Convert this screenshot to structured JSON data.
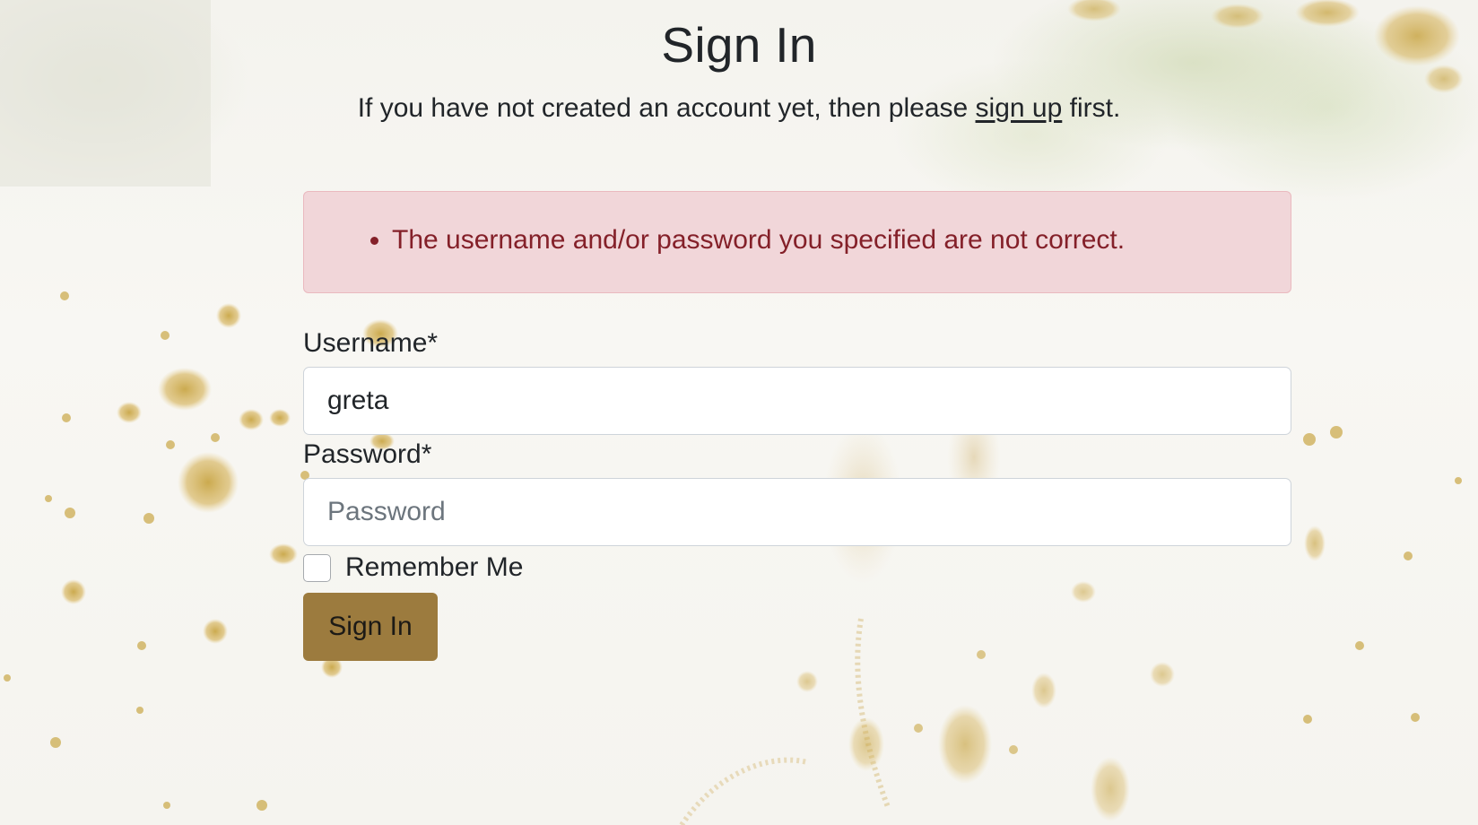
{
  "page": {
    "title": "Sign In",
    "subtitle_before": "If you have not created an account yet, then please ",
    "subtitle_link": "sign up",
    "subtitle_after": " first."
  },
  "alert": {
    "message": "The username and/or password you specified are not correct."
  },
  "form": {
    "username_label": "Username*",
    "username_value": "greta",
    "password_label": "Password*",
    "password_placeholder": "Password",
    "remember_label": "Remember Me",
    "remember_checked": false,
    "submit_label": "Sign In"
  },
  "colors": {
    "button": "#9c7b3e",
    "alert_bg": "#f1d6d9",
    "alert_text": "#842029"
  }
}
